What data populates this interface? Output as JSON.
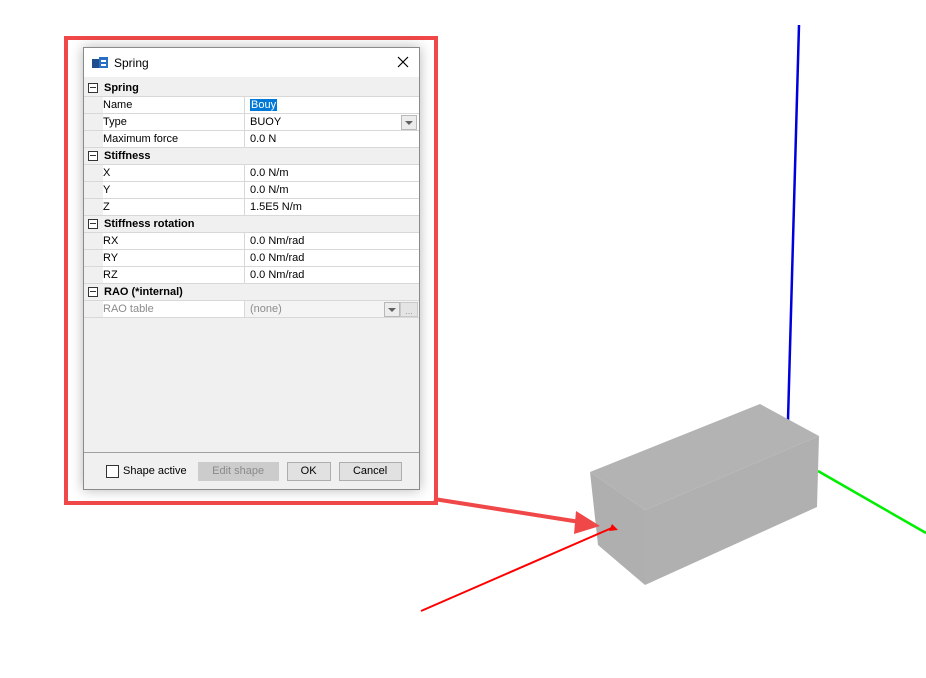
{
  "dialog": {
    "title": "Spring",
    "icon": "app-logo-icon",
    "close_icon": "close-icon"
  },
  "categories": [
    {
      "name": "Spring",
      "expanded": true,
      "rows": [
        {
          "label": "Name",
          "value": "Bouy",
          "selected": true
        },
        {
          "label": "Type",
          "value": "BUOY",
          "dropdown": true
        },
        {
          "label": "Maximum force",
          "value": "0.0 N"
        }
      ]
    },
    {
      "name": "Stiffness",
      "expanded": true,
      "rows": [
        {
          "label": "X",
          "value": "0.0 N/m"
        },
        {
          "label": "Y",
          "value": "0.0 N/m"
        },
        {
          "label": "Z",
          "value": "1.5E5 N/m"
        }
      ]
    },
    {
      "name": "Stiffness rotation",
      "expanded": true,
      "rows": [
        {
          "label": "RX",
          "value": "0.0 Nm/rad"
        },
        {
          "label": "RY",
          "value": "0.0 Nm/rad"
        },
        {
          "label": "RZ",
          "value": "0.0 Nm/rad"
        }
      ]
    },
    {
      "name": "RAO (*internal)",
      "expanded": true,
      "rows": [
        {
          "label": "RAO table",
          "value": "(none)",
          "dropdown": true,
          "ellipsis": "...",
          "disabled": true
        }
      ]
    }
  ],
  "footer": {
    "shape_active_label": "Shape active",
    "shape_active_checked": false,
    "edit_shape_label": "Edit shape",
    "edit_shape_enabled": false,
    "ok_label": "OK",
    "cancel_label": "Cancel"
  },
  "scene": {
    "axis_colors": {
      "x": "#ff0000",
      "y": "#00ee00",
      "z": "#0000dd"
    },
    "box_color": "#b0b0b0",
    "highlight_color": "#f04848"
  }
}
